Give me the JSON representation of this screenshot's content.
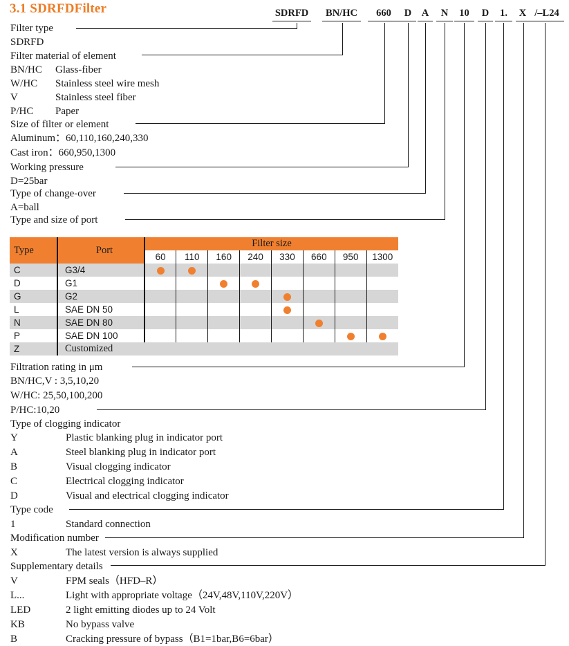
{
  "document": {
    "title": "3.1 SDRFDFilter",
    "accent_color": "#F08030",
    "title_color": "#ED7D26"
  },
  "order_code": {
    "segments": [
      {
        "label": "SDRFD",
        "name": "code-filter-type"
      },
      {
        "label": "BN/HC",
        "name": "code-filter-material"
      },
      {
        "label": "660",
        "name": "code-filter-size"
      },
      {
        "label": "D",
        "name": "code-working-pressure"
      },
      {
        "label": "A",
        "name": "code-change-over"
      },
      {
        "label": "N",
        "name": "code-port"
      },
      {
        "label": "10",
        "name": "code-filtration-rating"
      },
      {
        "label": "D",
        "name": "code-clogging-indicator"
      },
      {
        "label": "1.",
        "name": "code-type-code"
      },
      {
        "label": "X",
        "name": "code-modification-number"
      },
      {
        "label": "/–L24",
        "name": "code-supplementary-details"
      }
    ]
  },
  "sections": {
    "filter_type": {
      "heading": "Filter type",
      "entries": [
        {
          "code": "SDRFD",
          "desc": ""
        }
      ]
    },
    "filter_material": {
      "heading": "Filter material of element",
      "entries": [
        {
          "code": "BN/HC",
          "desc": "Glass-fiber"
        },
        {
          "code": "W/HC",
          "desc": "Stainless steel wire mesh"
        },
        {
          "code": "V",
          "desc": "Stainless steel fiber"
        },
        {
          "code": "P/HC",
          "desc": "Paper"
        }
      ]
    },
    "filter_size": {
      "heading": "Size of filter or element",
      "entries": [
        {
          "code": "Aluminum：60,110,160,240,330",
          "desc": ""
        },
        {
          "code": "Cast iron：660,950,1300",
          "desc": ""
        }
      ]
    },
    "working_pressure": {
      "heading": "Working pressure",
      "entries": [
        {
          "code": "D=25bar",
          "desc": ""
        }
      ]
    },
    "change_over": {
      "heading": "Type of change-over",
      "entries": [
        {
          "code": "A=ball",
          "desc": ""
        }
      ]
    },
    "port": {
      "heading": "Type and size of port"
    },
    "filtration_rating": {
      "heading": "Filtration rating in μm",
      "entries": [
        {
          "code": "BN/HC,V : 3,5,10,20",
          "desc": ""
        },
        {
          "code": "W/HC: 25,50,100,200",
          "desc": ""
        },
        {
          "code": "P/HC:10,20",
          "desc": ""
        }
      ]
    },
    "clogging_indicator": {
      "heading": "Type of clogging indicator",
      "entries": [
        {
          "code": "Y",
          "desc": "Plastic blanking plug in indicator port"
        },
        {
          "code": "A",
          "desc": "Steel blanking plug in indicator port"
        },
        {
          "code": "B",
          "desc": "Visual clogging indicator"
        },
        {
          "code": "C",
          "desc": "Electrical clogging indicator"
        },
        {
          "code": "D",
          "desc": "Visual and electrical clogging indicator"
        }
      ]
    },
    "type_code": {
      "heading": "Type code",
      "entries": [
        {
          "code": "1",
          "desc": "Standard connection"
        }
      ]
    },
    "modification_number": {
      "heading": "Modification number",
      "entries": [
        {
          "code": "X",
          "desc": "The latest version is always supplied"
        }
      ]
    },
    "supplementary_details": {
      "heading": "Supplementary details",
      "entries": [
        {
          "code": "V",
          "desc": "FPM seals（HFD–R）"
        },
        {
          "code": "L...",
          "desc": "Light with appropriate voltage（24V,48V,110V,220V）"
        },
        {
          "code": "LED",
          "desc": "2 light emitting diodes up to 24 Volt"
        },
        {
          "code": "KB",
          "desc": "No bypass valve"
        },
        {
          "code": "B",
          "desc": "Cracking pressure of bypass（B1=1bar,B6=6bar）"
        }
      ]
    }
  },
  "port_table": {
    "headers": {
      "type": "Type",
      "port": "Port",
      "filter_size": "Filter size",
      "sizes": [
        "60",
        "110",
        "160",
        "240",
        "330",
        "660",
        "950",
        "1300"
      ]
    },
    "customized_label": "Customized",
    "rows": [
      {
        "type": "C",
        "port": "G3/4",
        "marks": [
          1,
          1,
          0,
          0,
          0,
          0,
          0,
          0
        ]
      },
      {
        "type": "D",
        "port": "G1",
        "marks": [
          0,
          0,
          1,
          1,
          0,
          0,
          0,
          0
        ]
      },
      {
        "type": "G",
        "port": "G2",
        "marks": [
          0,
          0,
          0,
          0,
          1,
          0,
          0,
          0
        ]
      },
      {
        "type": "L",
        "port": "SAE DN 50",
        "marks": [
          0,
          0,
          0,
          0,
          1,
          0,
          0,
          0
        ]
      },
      {
        "type": "N",
        "port": "SAE DN 80",
        "marks": [
          0,
          0,
          0,
          0,
          0,
          1,
          0,
          0
        ]
      },
      {
        "type": "P",
        "port": "SAE DN 100",
        "marks": [
          0,
          0,
          0,
          0,
          0,
          0,
          1,
          1
        ]
      },
      {
        "type": "Z",
        "port": "",
        "customized": true
      }
    ]
  }
}
